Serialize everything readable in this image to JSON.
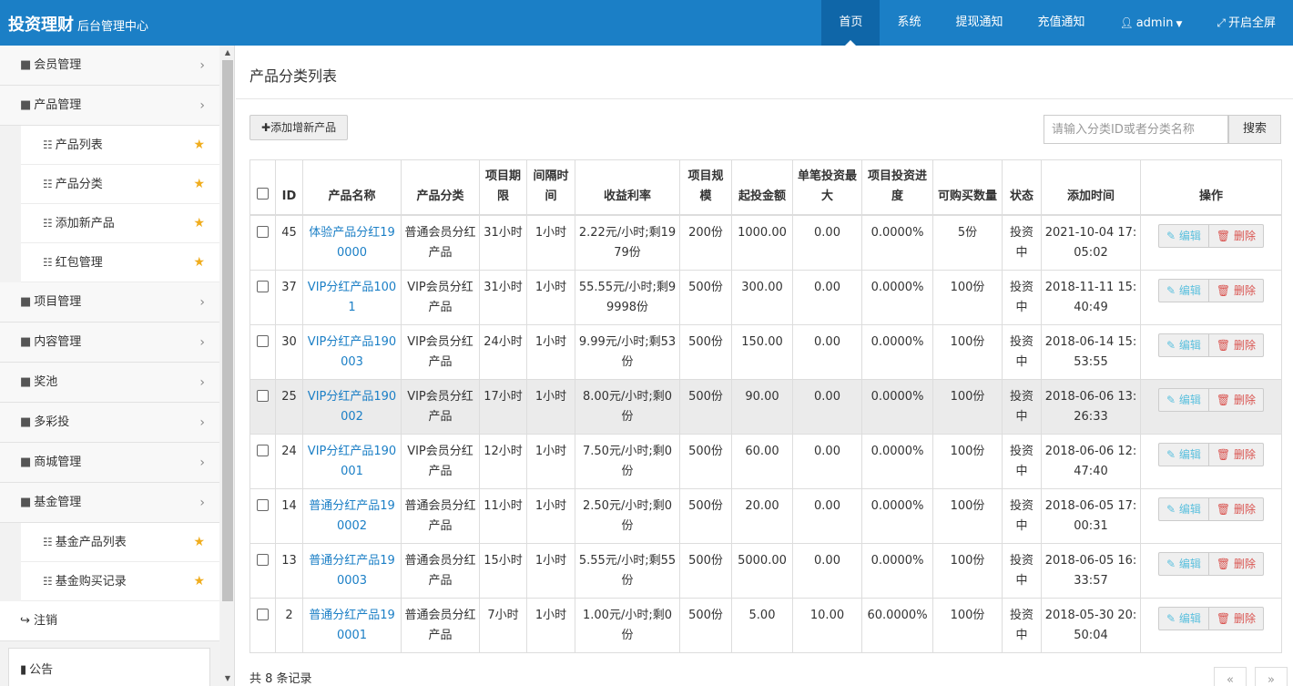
{
  "brand": {
    "main": "投资理财",
    "sub": "后台管理中心"
  },
  "nav": [
    {
      "label": "首页",
      "active": true
    },
    {
      "label": "系统"
    },
    {
      "label": "提现通知"
    },
    {
      "label": "充值通知"
    },
    {
      "label": "admin",
      "icon": "user-icon"
    },
    {
      "label": "开启全屏",
      "icon": "fullscreen-icon"
    }
  ],
  "sidebar": {
    "items": [
      {
        "label": "会员管理"
      },
      {
        "label": "产品管理",
        "sub": [
          "产品列表",
          "产品分类",
          "添加新产品",
          "红包管理"
        ]
      },
      {
        "label": "项目管理"
      },
      {
        "label": "内容管理"
      },
      {
        "label": "奖池"
      },
      {
        "label": "多彩投"
      },
      {
        "label": "商城管理"
      },
      {
        "label": "基金管理",
        "sub": [
          "基金产品列表",
          "基金购买记录"
        ]
      }
    ],
    "logout": "注销",
    "notice": "公告"
  },
  "page": {
    "title": "产品分类列表",
    "add_button": "添加增新产品",
    "search_placeholder": "请输入分类ID或者分类名称",
    "search_button": "搜索",
    "total": "共 8 条记录",
    "pager_prev": "«",
    "pager_next": "»"
  },
  "table": {
    "headers": [
      "ID",
      "产品名称",
      "产品分类",
      "项目期限",
      "间隔时间",
      "收益利率",
      "项目规模",
      "起投金额",
      "单笔投资最大",
      "项目投资进度",
      "可购买数量",
      "状态",
      "添加时间",
      "操作"
    ],
    "edit_label": "编辑",
    "delete_label": "删除",
    "rows": [
      {
        "id": "45",
        "name": "体验产品分红190000",
        "category": "普通会员分红产品",
        "term": "31小时",
        "interval": "1小时",
        "rate": "2.22元/小时;剩1979份",
        "scale": "200份",
        "min": "1000.00",
        "max": "0.00",
        "progress": "0.0000%",
        "qty": "5份",
        "status": "投资中",
        "time": "2021-10-04 17:05:02"
      },
      {
        "id": "37",
        "name": "VIP分红产品1001",
        "category": "VIP会员分红产品",
        "term": "31小时",
        "interval": "1小时",
        "rate": "55.55元/小时;剩99998份",
        "scale": "500份",
        "min": "300.00",
        "max": "0.00",
        "progress": "0.0000%",
        "qty": "100份",
        "status": "投资中",
        "time": "2018-11-11 15:40:49"
      },
      {
        "id": "30",
        "name": "VIP分红产品190003",
        "category": "VIP会员分红产品",
        "term": "24小时",
        "interval": "1小时",
        "rate": "9.99元/小时;剩53份",
        "scale": "500份",
        "min": "150.00",
        "max": "0.00",
        "progress": "0.0000%",
        "qty": "100份",
        "status": "投资中",
        "time": "2018-06-14 15:53:55"
      },
      {
        "id": "25",
        "name": "VIP分红产品190002",
        "category": "VIP会员分红产品",
        "term": "17小时",
        "interval": "1小时",
        "rate": "8.00元/小时;剩0份",
        "scale": "500份",
        "min": "90.00",
        "max": "0.00",
        "progress": "0.0000%",
        "qty": "100份",
        "status": "投资中",
        "time": "2018-06-06 13:26:33"
      },
      {
        "id": "24",
        "name": "VIP分红产品190001",
        "category": "VIP会员分红产品",
        "term": "12小时",
        "interval": "1小时",
        "rate": "7.50元/小时;剩0份",
        "scale": "500份",
        "min": "60.00",
        "max": "0.00",
        "progress": "0.0000%",
        "qty": "100份",
        "status": "投资中",
        "time": "2018-06-06 12:47:40"
      },
      {
        "id": "14",
        "name": "普通分红产品190002",
        "category": "普通会员分红产品",
        "term": "11小时",
        "interval": "1小时",
        "rate": "2.50元/小时;剩0份",
        "scale": "500份",
        "min": "20.00",
        "max": "0.00",
        "progress": "0.0000%",
        "qty": "100份",
        "status": "投资中",
        "time": "2018-06-05 17:00:31"
      },
      {
        "id": "13",
        "name": "普通分红产品190003",
        "category": "普通会员分红产品",
        "term": "15小时",
        "interval": "1小时",
        "rate": "5.55元/小时;剩55份",
        "scale": "500份",
        "min": "5000.00",
        "max": "0.00",
        "progress": "0.0000%",
        "qty": "100份",
        "status": "投资中",
        "time": "2018-06-05 16:33:57"
      },
      {
        "id": "2",
        "name": "普通分红产品190001",
        "category": "普通会员分红产品",
        "term": "7小时",
        "interval": "1小时",
        "rate": "1.00元/小时;剩0份",
        "scale": "500份",
        "min": "5.00",
        "max": "10.00",
        "progress": "60.0000%",
        "qty": "100份",
        "status": "投资中",
        "time": "2018-05-30 20:50:04"
      }
    ]
  }
}
